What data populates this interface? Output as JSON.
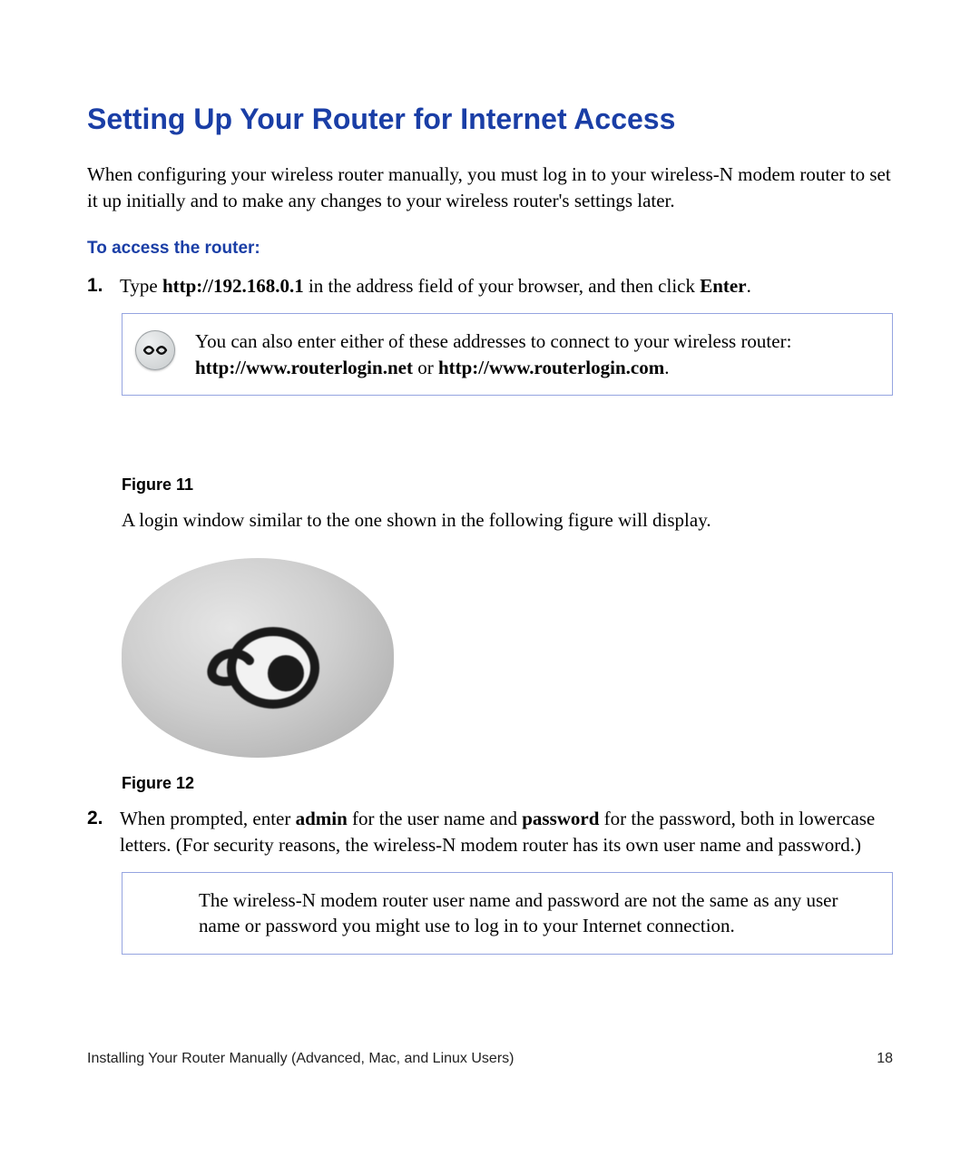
{
  "heading": "Setting Up Your Router for Internet Access",
  "intro": "When configuring your wireless router manually, you must log in to your wireless-N modem router to set it up initially and to make any changes to your wireless router's settings later.",
  "subhead": "To access the router:",
  "steps": [
    {
      "num": "1.",
      "pre": "Type ",
      "bold1": "http://192.168.0.1",
      "mid": " in the address field of your browser, and then click ",
      "bold2": "Enter",
      "post": "."
    },
    {
      "num": "2.",
      "pre": "When prompted, enter ",
      "bold1": "admin",
      "mid": " for the user name and ",
      "bold2": "password",
      "post": " for the password, both in lowercase letters. (For security reasons, the wireless-N modem router has its own user name and password.)"
    }
  ],
  "callout1": {
    "line1": "You can also enter either of these addresses to connect to your wireless router:",
    "boldA": "http://www.routerlogin.net",
    "sep": " or ",
    "boldB": "http://www.routerlogin.com",
    "tail": "."
  },
  "fig11_caption": "Figure 11",
  "fig11_after": "A login window similar to the one shown in the following figure will display.",
  "fig12_caption": "Figure 12",
  "callout2": "The wireless-N modem router user name and password are not the same as any user name or password you might use to log in to your Internet connection.",
  "footer_left": "Installing Your Router Manually (Advanced, Mac, and Linux Users)",
  "footer_page": "18"
}
